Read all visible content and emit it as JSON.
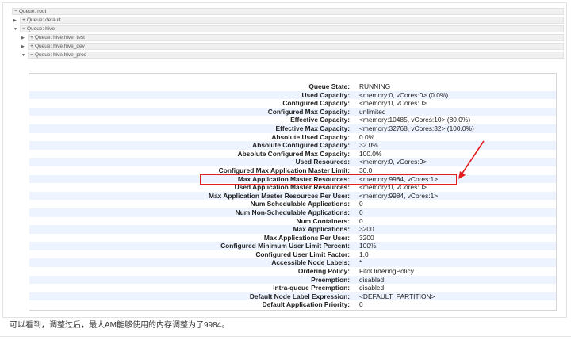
{
  "queues": {
    "root": {
      "toggle": "−",
      "label": "Queue: root"
    },
    "default": {
      "toggle": "+",
      "label": "Queue: default"
    },
    "hive": {
      "toggle": "−",
      "label": "Queue: hive"
    },
    "hive_test": {
      "toggle": "+",
      "label": "Queue: hive.hive_test"
    },
    "hive_dev": {
      "toggle": "+",
      "label": "Queue: hive.hive_dev"
    },
    "hive_prod": {
      "toggle": "−",
      "label": "Queue: hive.hive_prod"
    }
  },
  "details": [
    {
      "k": "Queue State:",
      "v": "RUNNING"
    },
    {
      "k": "Used Capacity:",
      "v": "<memory:0, vCores:0> (0.0%)"
    },
    {
      "k": "Configured Capacity:",
      "v": "<memory:0, vCores:0>"
    },
    {
      "k": "Configured Max Capacity:",
      "v": "unlimited"
    },
    {
      "k": "Effective Capacity:",
      "v": "<memory:10485, vCores:10> (80.0%)"
    },
    {
      "k": "Effective Max Capacity:",
      "v": "<memory:32768, vCores:32> (100.0%)"
    },
    {
      "k": "Absolute Used Capacity:",
      "v": "0.0%"
    },
    {
      "k": "Absolute Configured Capacity:",
      "v": "32.0%"
    },
    {
      "k": "Absolute Configured Max Capacity:",
      "v": "100.0%"
    },
    {
      "k": "Used Resources:",
      "v": "<memory:0, vCores:0>"
    },
    {
      "k": "Configured Max Application Master Limit:",
      "v": "30.0"
    },
    {
      "k": "Max Application Master Resources:",
      "v": "<memory:9984, vCores:1>"
    },
    {
      "k": "Used Application Master Resources:",
      "v": "<memory:0, vCores:0>"
    },
    {
      "k": "Max Application Master Resources Per User:",
      "v": "<memory:9984, vCores:1>"
    },
    {
      "k": "Num Schedulable Applications:",
      "v": "0"
    },
    {
      "k": "Num Non-Schedulable Applications:",
      "v": "0"
    },
    {
      "k": "Num Containers:",
      "v": "0"
    },
    {
      "k": "Max Applications:",
      "v": "3200"
    },
    {
      "k": "Max Applications Per User:",
      "v": "3200"
    },
    {
      "k": "Configured Minimum User Limit Percent:",
      "v": "100%"
    },
    {
      "k": "Configured User Limit Factor:",
      "v": "1.0"
    },
    {
      "k": "Accessible Node Labels:",
      "v": "*"
    },
    {
      "k": "Ordering Policy:",
      "v": "FifoOrderingPolicy"
    },
    {
      "k": "Preemption:",
      "v": "disabled"
    },
    {
      "k": "Intra-queue Preemption:",
      "v": "disabled"
    },
    {
      "k": "Default Node Label Expression:",
      "v": "<DEFAULT_PARTITION>"
    },
    {
      "k": "Default Application Priority:",
      "v": "0"
    }
  ],
  "caption": "可以看到，调整过后，最大AM能够使用的内存调整为了9984。",
  "colors": {
    "highlight": "#e02020",
    "row_alt": "#eef4ff"
  }
}
